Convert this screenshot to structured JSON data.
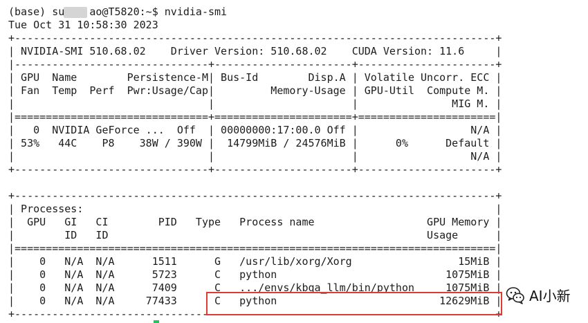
{
  "terminal": {
    "lines": [
      "(base) su    ao@T5820:~$ nvidia-smi",
      "Tue Oct 31 10:58:30 2023",
      "+-----------------------------------------------------------------------------+",
      "| NVIDIA-SMI 510.68.02    Driver Version: 510.68.02    CUDA Version: 11.6     |",
      "|-------------------------------+----------------------+----------------------+",
      "| GPU  Name        Persistence-M| Bus-Id        Disp.A | Volatile Uncorr. ECC |",
      "| Fan  Temp  Perf  Pwr:Usage/Cap|         Memory-Usage | GPU-Util  Compute M. |",
      "|                               |                      |               MIG M. |",
      "|===============================+======================+======================|",
      "|   0  NVIDIA GeForce ...  Off  | 00000000:17:00.0 Off |                  N/A |",
      "| 53%   44C    P8    38W / 390W |  14799MiB / 24576MiB |      0%      Default |",
      "|                               |                      |                  N/A |",
      "+-------------------------------+----------------------+----------------------+",
      "",
      "+-----------------------------------------------------------------------------+",
      "| Processes:                                                                  |",
      "|  GPU   GI   CI        PID   Type   Process name                  GPU Memory |",
      "|        ID   ID                                                   Usage      |",
      "|=============================================================================|",
      "|    0   N/A  N/A      1511      G   /usr/lib/xorg/Xorg                 15MiB |",
      "|    0   N/A  N/A      5723      C   python                           1075MiB |",
      "|    0   N/A  N/A      7409      C   .../envs/kbqa_llm/bin/python     1075MiB |",
      "|    0   N/A  N/A     77433      C   python                          12629MiB |",
      "+-----------------------------------------------------------------------------+"
    ]
  },
  "watermark": {
    "text": "AI小新",
    "icon": "wechat-icon"
  },
  "colors": {
    "text": "#1c1c1c",
    "highlight_border": "#e13a2e",
    "background": "#ffffff"
  }
}
